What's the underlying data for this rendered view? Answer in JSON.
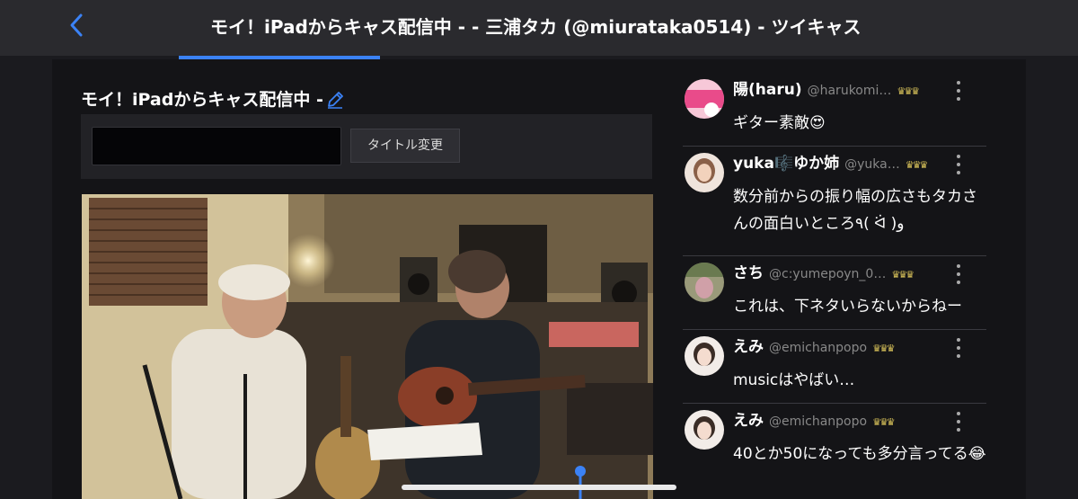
{
  "header": {
    "title": "モイ！iPadからキャス配信中 - - 三浦タカ (@miurataka0514) - ツイキャス",
    "back_icon": "chevron-left-icon",
    "accent_color": "#3b82f6"
  },
  "stream": {
    "title": "モイ！iPadからキャス配信中 -",
    "edit_icon": "pencil-icon",
    "title_input_value": "",
    "title_change_label": "タイトル変更"
  },
  "comments": [
    {
      "name": "陽(haru)",
      "handle": "@harukomi…",
      "badge": "♛♛♛",
      "text": "ギター素敵😍"
    },
    {
      "name": "yuka🎼ゆか姉",
      "handle": "@yuka…",
      "badge": "♛♛♛",
      "text": "数分前からの振り幅の広さもタカさんの面白いところ٩( ᐛ )و"
    },
    {
      "name": "さち",
      "handle": "@c:yumepoyn_0…",
      "badge": "♛♛♛",
      "text": "これは、下ネタいらないからねー"
    },
    {
      "name": "えみ",
      "handle": "@emichanpopo",
      "badge": "♛♛♛",
      "text": "musicはやばい…"
    },
    {
      "name": "えみ",
      "handle": "@emichanpopo",
      "badge": "♛♛♛",
      "text": "40とか50になっても多分言ってる😂"
    }
  ]
}
